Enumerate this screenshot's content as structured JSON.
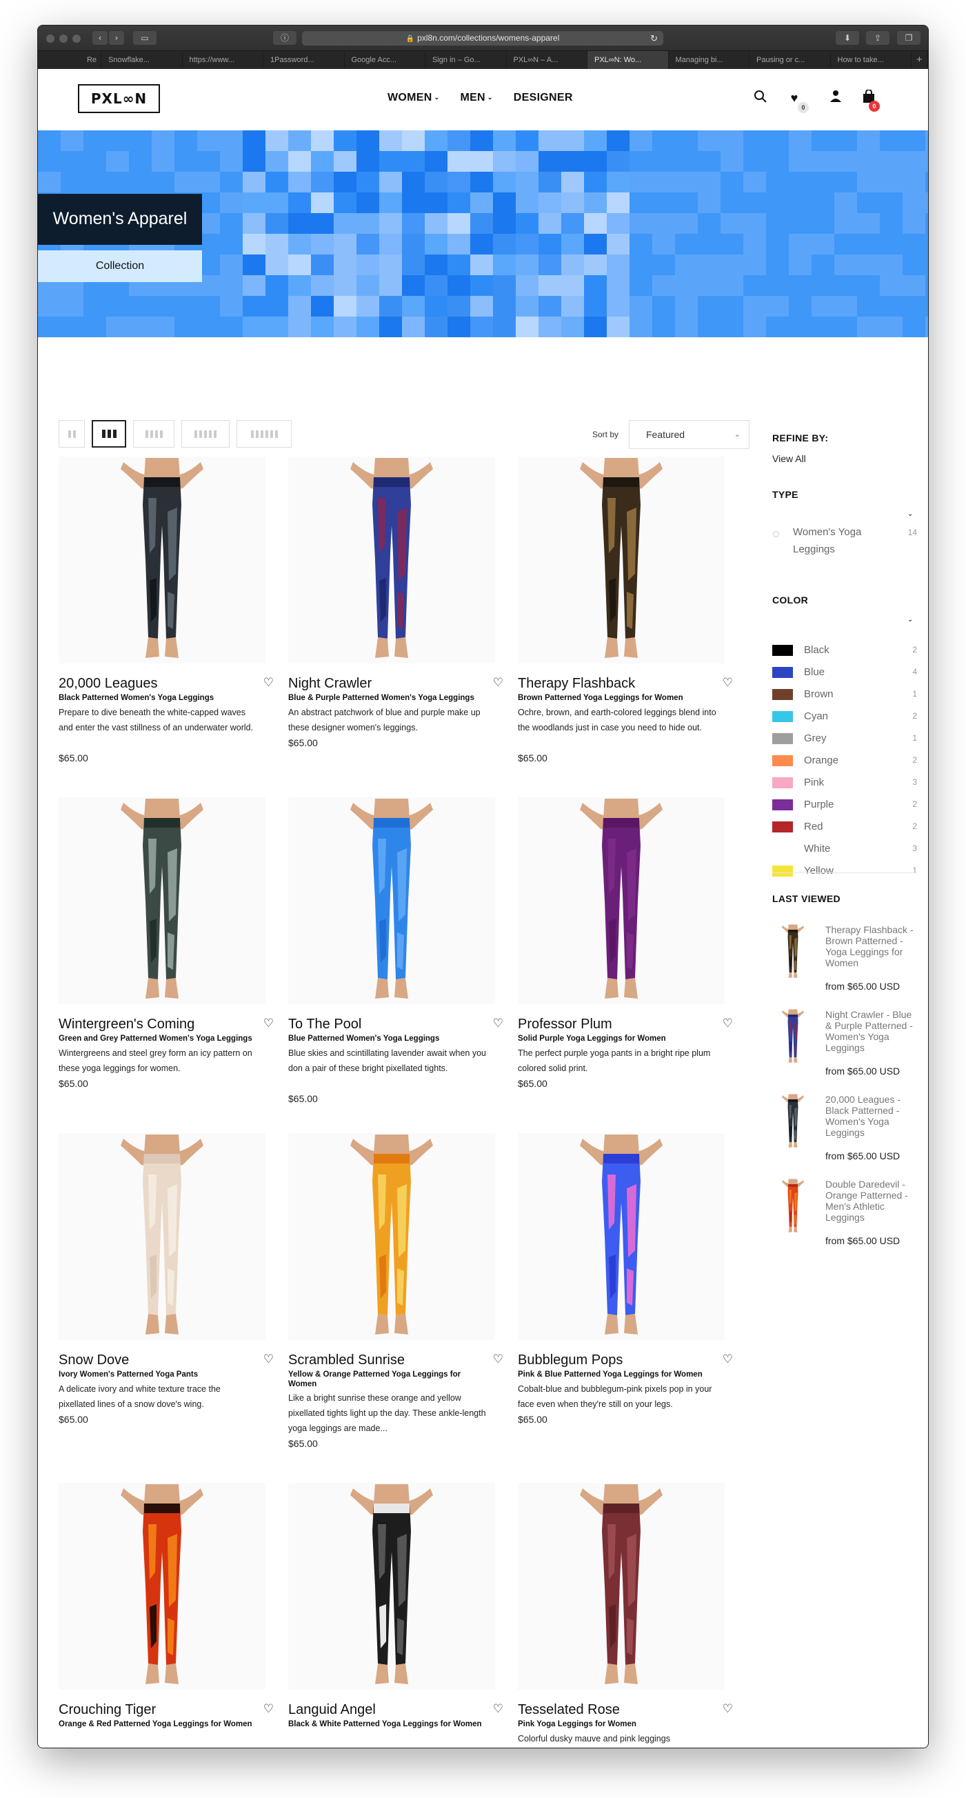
{
  "browser": {
    "url": "pxl8n.com/collections/womens-apparel",
    "tabs": [
      "Re",
      "Snowflake...",
      "https://www...",
      "1Password...",
      "Google Acc...",
      "Sign in – Go...",
      "PXL∞N – A...",
      "PXL∞N: Wo...",
      "Managing bi...",
      "Pausing or c...",
      "How to take..."
    ],
    "active_tab_index": 7,
    "new_tab": "+"
  },
  "header": {
    "logo": "PXL∞N",
    "nav": [
      {
        "label": "WOMEN",
        "caret": "⌄"
      },
      {
        "label": "MEN",
        "caret": "⌄"
      },
      {
        "label": "DESIGNER",
        "caret": ""
      }
    ],
    "wishlist_count": "0",
    "cart_count": "0"
  },
  "hero": {
    "title": "Women's Apparel",
    "subtitle": "Collection"
  },
  "toolbar": {
    "sort_label": "Sort by",
    "sort_value": "Featured",
    "grid_options": [
      2,
      3,
      4,
      5,
      6
    ],
    "grid_selected": 3
  },
  "products": [
    {
      "name": "20,000 Leagues",
      "subtitle": "Black Patterned Women's Yoga Leggings",
      "desc": "Prepare to dive beneath the white-capped waves and enter the vast stillness of an underwater world.",
      "price": "$65.00",
      "colors": [
        "#2a3035",
        "#56616a",
        "#14181c"
      ]
    },
    {
      "name": "Night Crawler",
      "subtitle": "Blue & Purple Patterned Women's Yoga Leggings",
      "desc": "An abstract patchwork of blue and purple make up these designer women's leggings.",
      "price": "$65.00",
      "colors": [
        "#2f3f9a",
        "#7b2a60",
        "#1f2a72"
      ]
    },
    {
      "name": "Therapy Flashback",
      "subtitle": "Brown Patterned Yoga Leggings for Women",
      "desc": "Ochre, brown, and earth-colored leggings blend into the woodlands just in case you need to hide out.",
      "price": "$65.00",
      "colors": [
        "#3a2b1b",
        "#8a6a3a",
        "#1e1810"
      ]
    },
    {
      "name": "Wintergreen's Coming",
      "subtitle": "Green and Grey Patterned Women's Yoga Leggings",
      "desc": "Wintergreens and steel grey form an icy pattern on these yoga leggings for women.",
      "price": "$65.00",
      "colors": [
        "#3c4a46",
        "#8a9b95",
        "#22302c"
      ]
    },
    {
      "name": "To The Pool",
      "subtitle": "Blue Patterned Women's Yoga Leggings",
      "desc": "Blue skies and scintillating lavender await when you don a pair of these bright pixellated tights.",
      "price": "$65.00",
      "colors": [
        "#2f86ea",
        "#5aa4f4",
        "#1f6fd6"
      ]
    },
    {
      "name": "Professor Plum",
      "subtitle": "Solid Purple Yoga Leggings for Women",
      "desc": "The perfect purple yoga pants in a bright ripe plum colored solid print.",
      "price": "$65.00",
      "colors": [
        "#6a1f78",
        "#7b2a88",
        "#5b1766"
      ]
    },
    {
      "name": "Snow Dove",
      "subtitle": "Ivory Women's Patterned Yoga Pants",
      "desc": "A delicate ivory and white texture trace the pixellated lines of a snow dove's wing.",
      "price": "$65.00",
      "colors": [
        "#ead9c8",
        "#f4ebe0",
        "#dcc8b4"
      ]
    },
    {
      "name": "Scrambled Sunrise",
      "subtitle": "Yellow & Orange Patterned Yoga Leggings for Women",
      "desc": "Like a bright sunrise these orange and yellow pixellated tights light up the day. These ankle-length yoga leggings are made...",
      "price": "$65.00",
      "colors": [
        "#f0a021",
        "#f6cf5a",
        "#e27a10"
      ]
    },
    {
      "name": "Bubblegum Pops",
      "subtitle": "Pink & Blue Patterned Yoga Leggings for Women",
      "desc": "Cobalt-blue and bubblegum-pink pixels pop in your face even when they're still on your legs.",
      "price": "$65.00",
      "colors": [
        "#3d5cf0",
        "#d86ad8",
        "#2b3fd6"
      ]
    },
    {
      "name": "Crouching Tiger",
      "subtitle": "Orange & Red Patterned Yoga Leggings for Women",
      "desc": "",
      "price": "",
      "colors": [
        "#d6340f",
        "#f07a14",
        "#2a0f08"
      ]
    },
    {
      "name": "Languid Angel",
      "subtitle": "Black & White Patterned Yoga Leggings for Women",
      "desc": "",
      "price": "",
      "colors": [
        "#1d1d1d",
        "#555555",
        "#e8e8e8"
      ]
    },
    {
      "name": "Tesselated Rose",
      "subtitle": "Pink Yoga Leggings for Women",
      "desc": "Colorful dusky mauve and pink leggings",
      "price": "",
      "colors": [
        "#7a2f34",
        "#9a4a4e",
        "#5e2226"
      ]
    }
  ],
  "sidebar": {
    "refine_title": "REFINE BY:",
    "view_all": "View All",
    "type_title": "TYPE",
    "types": [
      {
        "label": "Women's Yoga",
        "label2": "Leggings",
        "count": "14"
      }
    ],
    "color_title": "COLOR",
    "colors": [
      {
        "name": "Black",
        "count": "2",
        "hex": "#000000"
      },
      {
        "name": "Blue",
        "count": "4",
        "hex": "#2b44c4"
      },
      {
        "name": "Brown",
        "count": "1",
        "hex": "#70412a"
      },
      {
        "name": "Cyan",
        "count": "2",
        "hex": "#38c6e8"
      },
      {
        "name": "Grey",
        "count": "1",
        "hex": "#9e9e9e"
      },
      {
        "name": "Orange",
        "count": "2",
        "hex": "#ff8a4e"
      },
      {
        "name": "Pink",
        "count": "3",
        "hex": "#f8a8c4"
      },
      {
        "name": "Purple",
        "count": "2",
        "hex": "#7a2e9a"
      },
      {
        "name": "Red",
        "count": "2",
        "hex": "#b3262a"
      },
      {
        "name": "White",
        "count": "3",
        "hex": "#ffffff"
      },
      {
        "name": "Yellow",
        "count": "1",
        "hex": "#f6e43a"
      }
    ],
    "last_viewed_title": "LAST VIEWED",
    "last_viewed": [
      {
        "title": "Therapy Flashback - Brown Patterned - Yoga Leggings for Women",
        "price": "from $65.00 USD",
        "colors": [
          "#3a2b1b",
          "#8a6a3a",
          "#1e1810"
        ]
      },
      {
        "title": "Night Crawler - Blue & Purple Patterned - Women's Yoga Leggings",
        "price": "from $65.00 USD",
        "colors": [
          "#2f3f9a",
          "#7b2a60",
          "#1f2a72"
        ]
      },
      {
        "title": "20,000 Leagues - Black Patterned - Women's Yoga Leggings",
        "price": "from $65.00 USD",
        "colors": [
          "#2a3035",
          "#56616a",
          "#14181c"
        ]
      },
      {
        "title": "Double Daredevil - Orange Patterned - Men's Athletic Leggings",
        "price": "from $65.00 USD",
        "colors": [
          "#e0451a",
          "#f07a14",
          "#b12a0c"
        ]
      }
    ]
  }
}
